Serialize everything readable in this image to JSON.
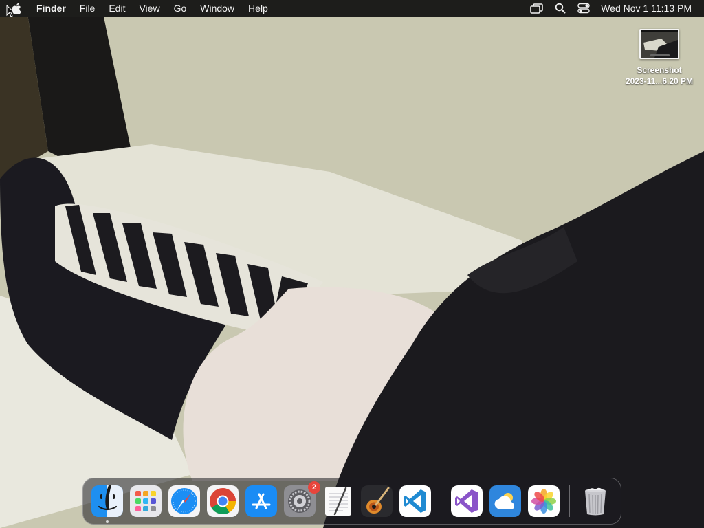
{
  "menubar": {
    "apple_icon": "apple-logo-icon",
    "app_name": "Finder",
    "menus": [
      "File",
      "Edit",
      "View",
      "Go",
      "Window",
      "Help"
    ],
    "status_icons": [
      "screen-mirroring-icon",
      "spotlight-search-icon",
      "control-center-icon"
    ],
    "clock": "Wed Nov 1  11:13 PM"
  },
  "desktop": {
    "files": [
      {
        "name_line1": "Screenshot",
        "name_line2": "2023-11...6.20 PM"
      }
    ]
  },
  "dock": {
    "apps": [
      {
        "icon": "finder-icon",
        "running": true
      },
      {
        "icon": "launchpad-icon"
      },
      {
        "icon": "safari-icon"
      },
      {
        "icon": "chrome-icon"
      },
      {
        "icon": "app-store-icon"
      },
      {
        "icon": "system-settings-icon",
        "badge": "2"
      },
      {
        "icon": "textedit-icon"
      },
      {
        "icon": "garageband-icon"
      },
      {
        "icon": "vscode-icon"
      },
      {
        "icon": "visual-studio-icon"
      },
      {
        "icon": "weather-icon"
      },
      {
        "icon": "photos-icon"
      },
      {
        "icon": "trash-icon"
      }
    ]
  },
  "colors": {
    "menubar_bg": "#1d1d1b",
    "badge": "#e8453c"
  }
}
